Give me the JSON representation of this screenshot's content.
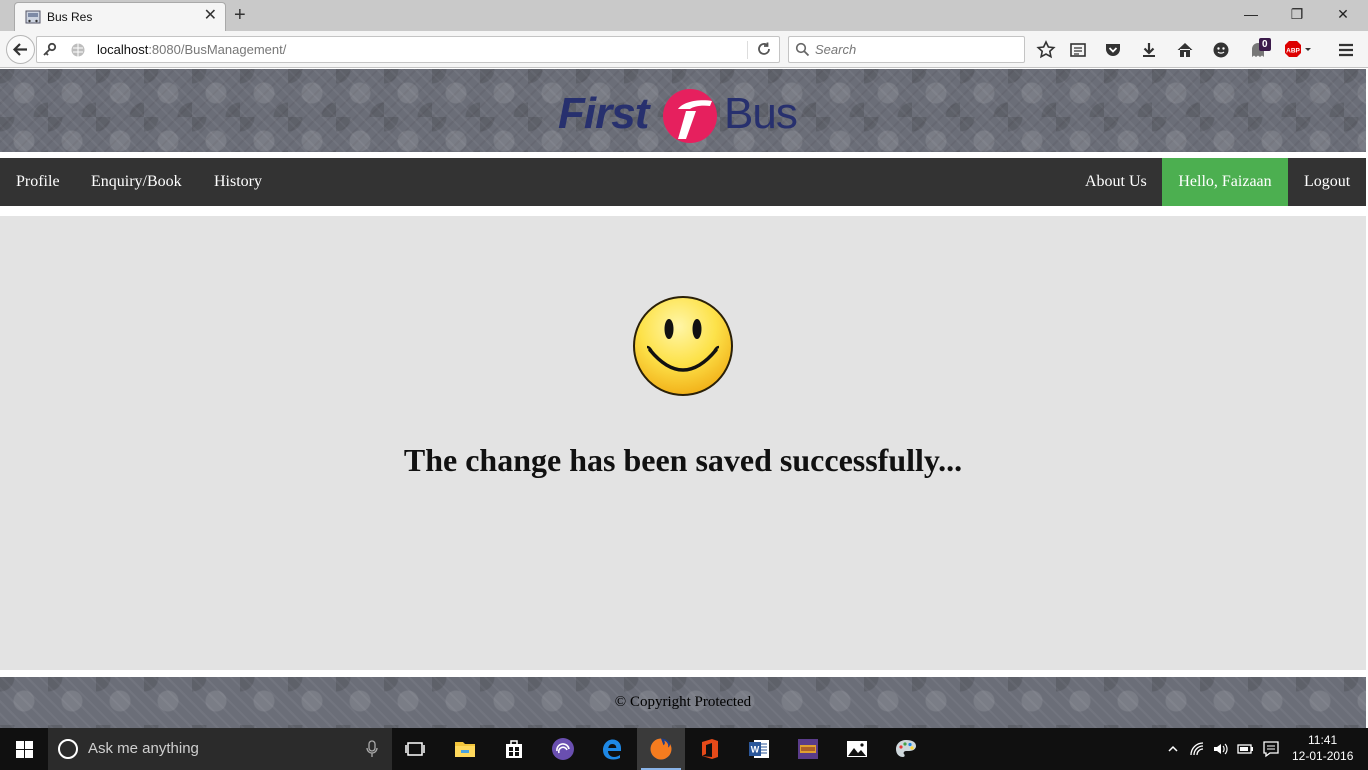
{
  "browser": {
    "tab_title": "Bus Res",
    "tab_close": "✕",
    "new_tab": "+",
    "window_controls": {
      "minimize": "—",
      "restore": "❐",
      "close": "✕"
    },
    "url_host": "localhost",
    "url_rest": ":8080/BusManagement/",
    "search_placeholder": "Search",
    "adblock_count": "0"
  },
  "site": {
    "logo_left": "First",
    "logo_right": "Bus",
    "nav": {
      "profile": "Profile",
      "enquiry": "Enquiry/Book",
      "history": "History",
      "about": "About Us",
      "greeting": "Hello, Faizaan",
      "logout": "Logout"
    },
    "message": "The change has been saved successfully...",
    "footer": "© Copyright Protected"
  },
  "taskbar": {
    "search_placeholder": "Ask me anything",
    "time": "11:41",
    "date": "12-01-2016"
  },
  "colors": {
    "nav_bg": "#333333",
    "greeting_bg": "#4caf50",
    "content_bg": "#e3e3e3",
    "logo_blue": "#27306e",
    "logo_pink": "#e6205e"
  }
}
